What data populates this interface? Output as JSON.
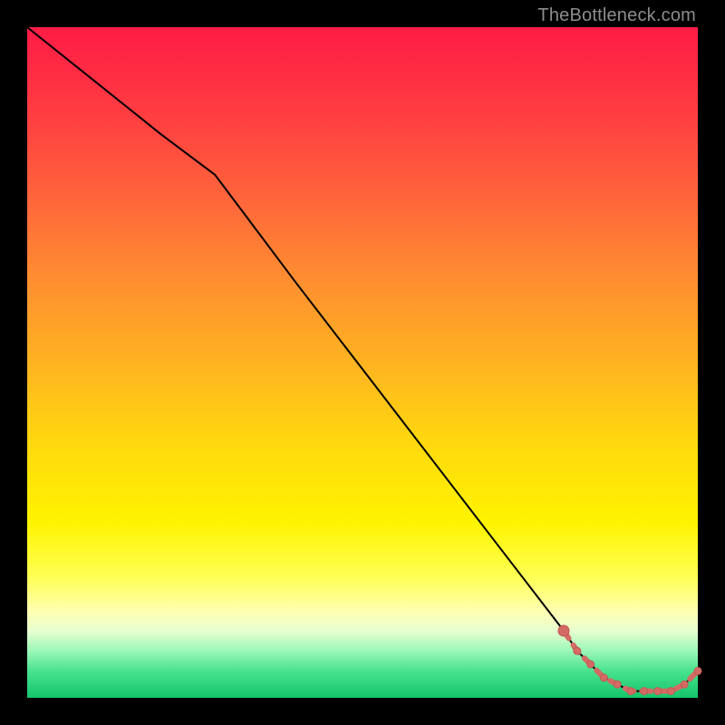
{
  "watermark": "TheBottleneck.com",
  "colors": {
    "line": "#000000",
    "marker_fill": "#d36b64",
    "marker_stroke": "#c05a54",
    "bg_black": "#000000"
  },
  "chart_data": {
    "type": "line",
    "title": "",
    "xlabel": "",
    "ylabel": "",
    "xlim": [
      0,
      100
    ],
    "ylim": [
      0,
      100
    ],
    "grid": false,
    "legend": false,
    "series": [
      {
        "name": "curve",
        "x": [
          0,
          10,
          20,
          28,
          40,
          50,
          60,
          70,
          80,
          82,
          84,
          86,
          88,
          90,
          92,
          94,
          96,
          98,
          100
        ],
        "y": [
          100,
          92,
          84,
          78,
          62,
          49,
          36,
          23,
          10,
          7,
          5,
          3,
          2,
          1,
          1,
          1,
          1,
          2,
          4
        ]
      }
    ],
    "markers": {
      "name": "highlight",
      "x": [
        80,
        82,
        84,
        86,
        88,
        90,
        92,
        94,
        96,
        98,
        100
      ],
      "y": [
        10,
        7,
        5,
        3,
        2,
        1,
        1,
        1,
        1,
        2,
        4
      ],
      "style": "dashed-between-with-dots"
    }
  }
}
